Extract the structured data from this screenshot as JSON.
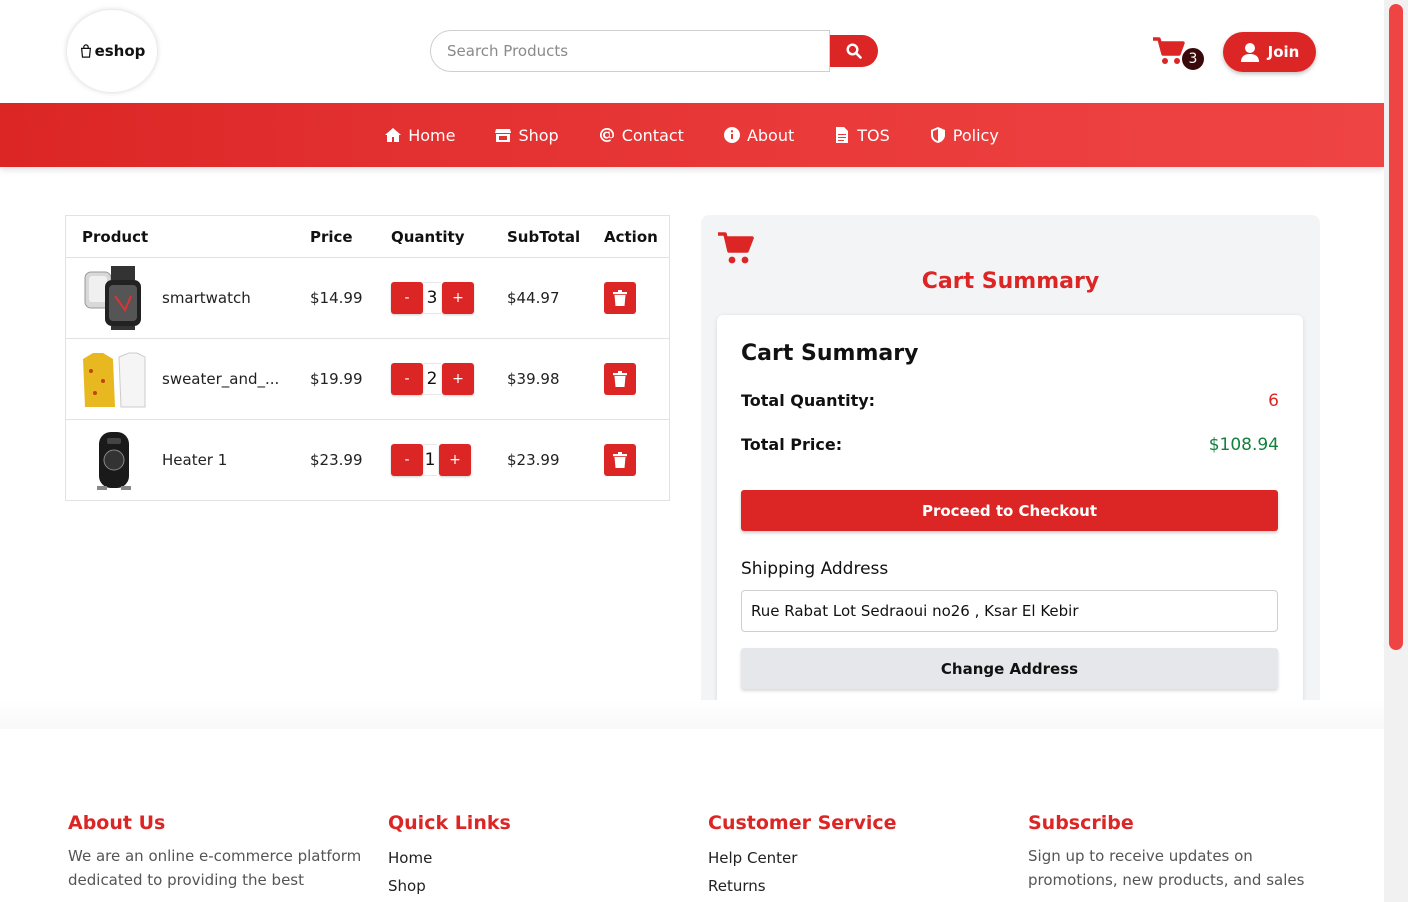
{
  "header": {
    "logo_text": "eshop",
    "search_placeholder": "Search Products",
    "cart_count": "3",
    "join_label": "Join"
  },
  "nav": {
    "items": [
      {
        "label": "Home",
        "icon": "home-icon"
      },
      {
        "label": "Shop",
        "icon": "store-icon"
      },
      {
        "label": "Contact",
        "icon": "at-icon"
      },
      {
        "label": "About",
        "icon": "info-icon"
      },
      {
        "label": "TOS",
        "icon": "document-icon"
      },
      {
        "label": "Policy",
        "icon": "shield-icon"
      }
    ]
  },
  "cart_table": {
    "headers": [
      "Product",
      "Price",
      "Quantity",
      "SubTotal",
      "Action"
    ],
    "rows": [
      {
        "name": "smartwatch",
        "price": "$14.99",
        "qty": "3",
        "subtotal": "$44.97"
      },
      {
        "name": "sweater_and_...",
        "price": "$19.99",
        "qty": "2",
        "subtotal": "$39.98"
      },
      {
        "name": "Heater 1",
        "price": "$23.99",
        "qty": "1",
        "subtotal": "$23.99"
      }
    ],
    "minus_label": "-",
    "plus_label": "+"
  },
  "summary": {
    "panel_title": "Cart Summary",
    "card_title": "Cart Summary",
    "total_qty_label": "Total Quantity:",
    "total_qty": "6",
    "total_price_label": "Total Price:",
    "total_price": "$108.94",
    "checkout_label": "Proceed to Checkout",
    "shipping_label": "Shipping Address",
    "address": "Rue Rabat Lot Sedraoui no26 , Ksar El Kebir",
    "change_label": "Change Address"
  },
  "footer": {
    "about": {
      "title": "About Us",
      "text": "We are an online e-commerce platform dedicated to providing the best"
    },
    "quick_links": {
      "title": "Quick Links",
      "links": [
        "Home",
        "Shop"
      ]
    },
    "customer_service": {
      "title": "Customer Service",
      "links": [
        "Help Center",
        "Returns"
      ]
    },
    "subscribe": {
      "title": "Subscribe",
      "text": "Sign up to receive updates on promotions, new products, and sales"
    }
  },
  "colors": {
    "accent": "#dc2626",
    "price_green": "#15803d",
    "panel_bg": "#f3f4f6"
  }
}
